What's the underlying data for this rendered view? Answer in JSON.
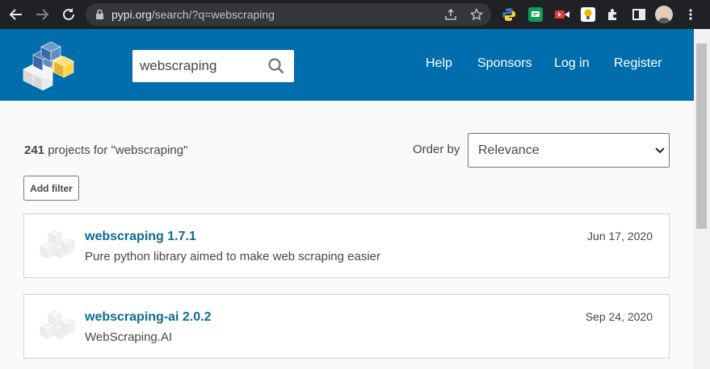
{
  "browser": {
    "url_host": "pypi.org",
    "url_path": "/search/?q=webscraping"
  },
  "header": {
    "search_value": "webscraping",
    "nav": [
      "Help",
      "Sponsors",
      "Log in",
      "Register"
    ]
  },
  "results": {
    "count": "241",
    "count_suffix": " projects for \"webscraping\"",
    "order_label": "Order by",
    "order_value": "Relevance",
    "filter_label": "Add filter",
    "items": [
      {
        "name": "webscraping 1.7.1",
        "description": "Pure python library aimed to make web scraping easier",
        "date": "Jun 17, 2020"
      },
      {
        "name": "webscraping-ai 2.0.2",
        "description": "WebScraping.AI",
        "date": "Sep 24, 2020"
      }
    ]
  },
  "colors": {
    "header_bg": "#006dad",
    "link": "#0c6a94",
    "browser_bg": "#202124"
  }
}
